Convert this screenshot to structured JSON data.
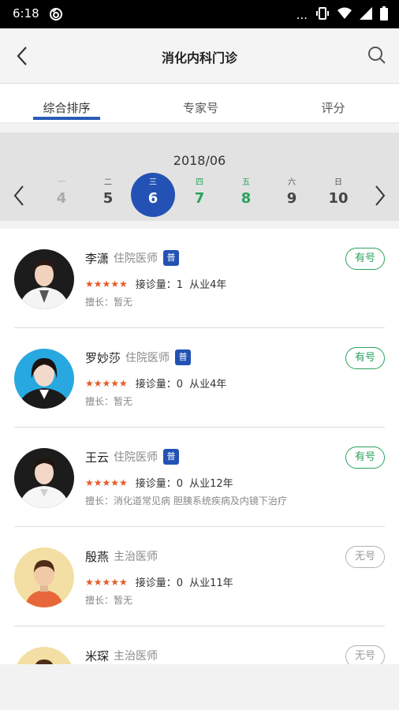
{
  "status": {
    "time": "6:18",
    "dots": "..."
  },
  "header": {
    "title": "消化内科门诊"
  },
  "tabs": [
    {
      "label": "综合排序"
    },
    {
      "label": "专家号"
    },
    {
      "label": "评分"
    }
  ],
  "calendar": {
    "month": "2018/06",
    "days": [
      {
        "weekday": "一",
        "date": "4",
        "state": "past"
      },
      {
        "weekday": "二",
        "date": "5",
        "state": "normal"
      },
      {
        "weekday": "三",
        "date": "6",
        "state": "selected"
      },
      {
        "weekday": "四",
        "date": "7",
        "state": "available"
      },
      {
        "weekday": "五",
        "date": "8",
        "state": "available"
      },
      {
        "weekday": "六",
        "date": "9",
        "state": "normal"
      },
      {
        "weekday": "日",
        "date": "10",
        "state": "normal"
      }
    ]
  },
  "doctors": [
    {
      "name": "李潇",
      "title": "住院医师",
      "badge": "普",
      "stars": "★★★★★",
      "visits": "接诊量：1",
      "years": "从业4年",
      "specialty": "擅长：暂无",
      "status": "有号",
      "available": true
    },
    {
      "name": "罗妙莎",
      "title": "住院医师",
      "badge": "普",
      "stars": "★★★★★",
      "visits": "接诊量：0",
      "years": "从业4年",
      "specialty": "擅长：暂无",
      "status": "有号",
      "available": true
    },
    {
      "name": "王云",
      "title": "住院医师",
      "badge": "普",
      "stars": "★★★★★",
      "visits": "接诊量：0",
      "years": "从业12年",
      "specialty": "擅长：消化道常见病 胆胰系统疾病及内镜下治疗",
      "status": "有号",
      "available": true
    },
    {
      "name": "殷燕",
      "title": "主治医师",
      "badge": "",
      "stars": "★★★★★",
      "visits": "接诊量：0",
      "years": "从业11年",
      "specialty": "擅长：暂无",
      "status": "无号",
      "available": false
    },
    {
      "name": "米琛",
      "title": "主治医师",
      "badge": "",
      "stars": "",
      "visits": "",
      "years": "",
      "specialty": "",
      "status": "无号",
      "available": false
    }
  ],
  "colors": {
    "accent": "#2352b4",
    "available": "#2aa25c",
    "stars": "#e65a26"
  }
}
